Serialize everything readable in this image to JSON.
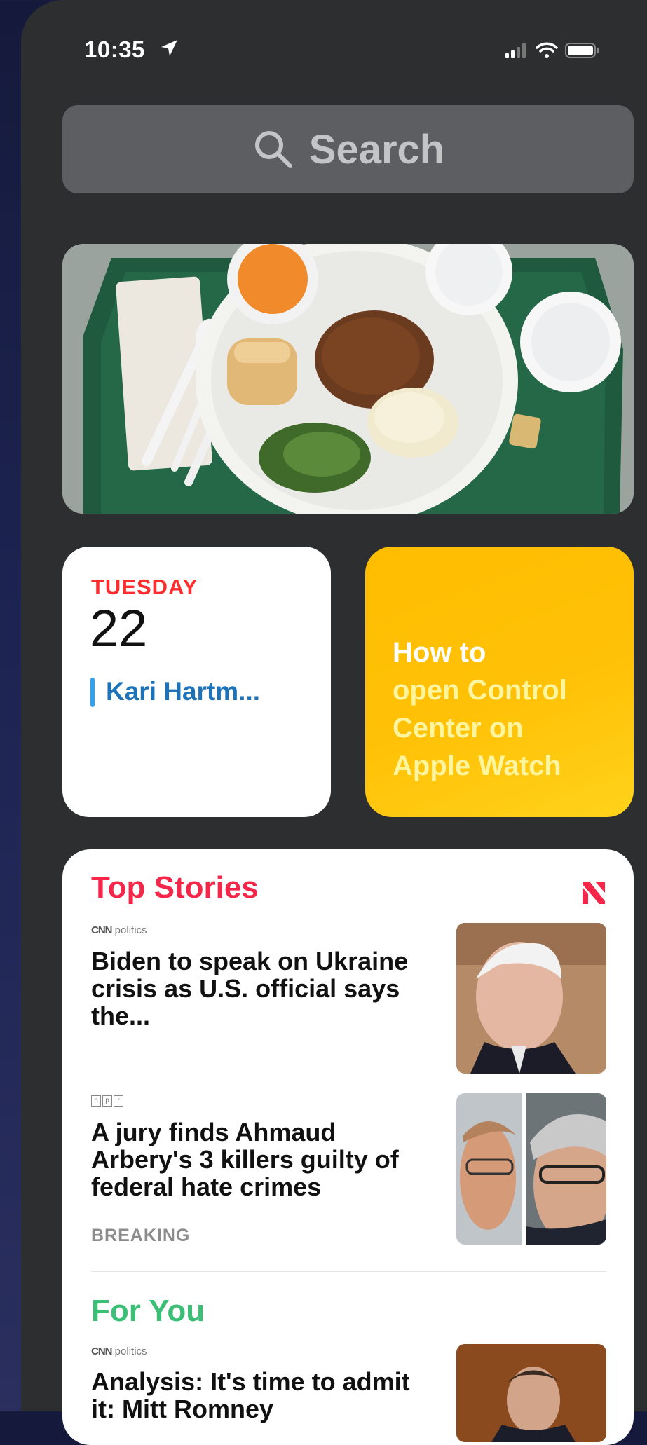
{
  "status_bar": {
    "time": "10:35"
  },
  "search": {
    "placeholder": "Search"
  },
  "calendar": {
    "day": "TUESDAY",
    "date": "22",
    "event": "Kari Hartm..."
  },
  "tip": {
    "line1": "How to",
    "line2": "open Control",
    "line3": "Center on",
    "line4": "Apple Watch"
  },
  "news": {
    "top_stories": {
      "title": "Top Stories",
      "items": [
        {
          "source": "CNN",
          "source_sub": "politics",
          "headline": "Biden to speak on Ukraine crisis as U.S. official says the..."
        },
        {
          "source_letters": [
            "n",
            "p",
            "r"
          ],
          "headline": "A jury finds Ahmaud Arbery's 3 killers guilty of federal hate crimes",
          "tag": "BREAKING"
        }
      ]
    },
    "for_you": {
      "title": "For You",
      "items": [
        {
          "source": "CNN",
          "source_sub": "politics",
          "headline": "Analysis: It's time to admit it: Mitt Romney"
        }
      ]
    }
  },
  "colors": {
    "calendar_day": "#ff2d2d",
    "event_bar": "#2ea3f2",
    "top_stories": "#f5264a",
    "for_you": "#3bbf77",
    "tip_bg": "#ffc107"
  }
}
